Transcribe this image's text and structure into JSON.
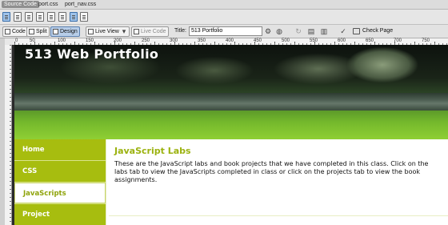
{
  "related_files": {
    "tabs": [
      "Source Code",
      "port.css",
      "port_nav.css"
    ]
  },
  "icon_row": {
    "icons": [
      "code-view-icon",
      "doc-icon",
      "doc-icon",
      "doc-icon",
      "doc-icon",
      "doc-icon",
      "doc-icon",
      "doc-icon",
      "doc-icon"
    ]
  },
  "toolbar": {
    "code_label": "Code",
    "split_label": "Split",
    "design_label": "Design",
    "live_view_label": "Live View",
    "live_code_label": "Live Code",
    "title_label": "Title:",
    "title_value": "513 Portfolio",
    "check_page_label": "Check Page",
    "tool_glyphs": [
      "⚙",
      "⟳",
      "↻",
      "▤",
      "▥"
    ]
  },
  "ruler": {
    "ticks": [
      "0",
      "50",
      "100",
      "150",
      "200",
      "250",
      "300",
      "350",
      "400",
      "450",
      "500",
      "550",
      "600",
      "650",
      "700",
      "750"
    ]
  },
  "page": {
    "banner_title": "513 Web Portfolio",
    "nav": [
      {
        "label": "Home",
        "current": false
      },
      {
        "label": "CSS",
        "current": false
      },
      {
        "label": "JavaScripts",
        "current": true
      },
      {
        "label": "Project",
        "current": false
      }
    ],
    "heading": "JavaScript Labs",
    "body": "These are the JavaScript labs and book projects that we have completed in this class. Click on the labs tab to view the JavaScripts completed in class or click on the projects tab to view the book assignments."
  },
  "colors": {
    "nav_green": "#a7bd0f",
    "heading_green": "#9bb20f"
  }
}
